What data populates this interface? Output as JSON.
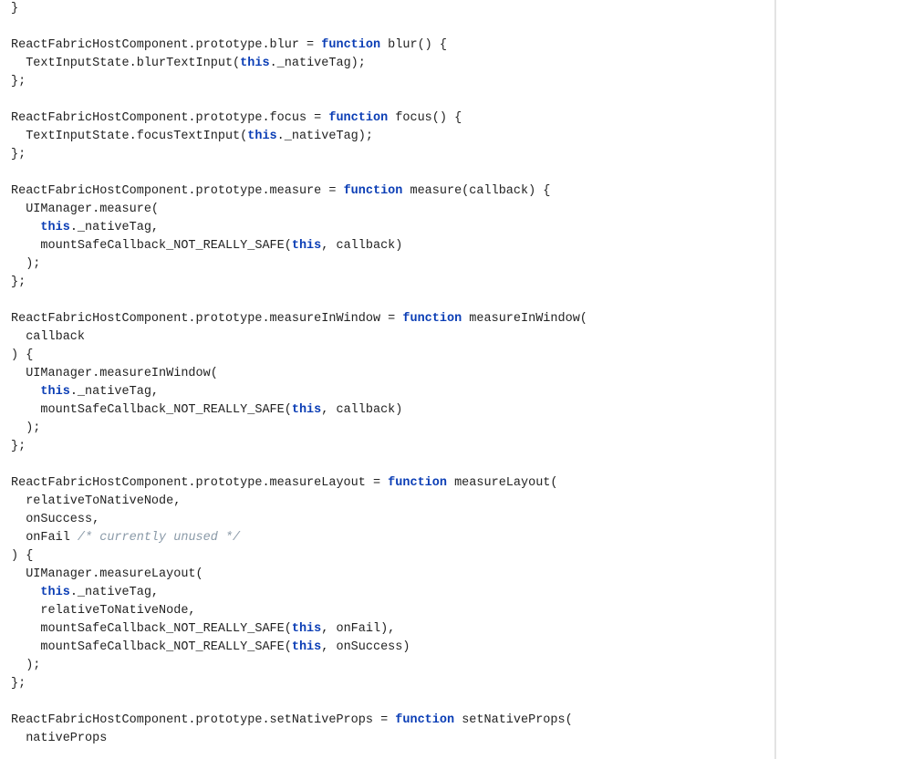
{
  "tokens": [
    {
      "t": "}",
      "c": ""
    },
    {
      "t": "\n",
      "c": ""
    },
    {
      "t": "\n",
      "c": ""
    },
    {
      "t": "ReactFabricHostComponent.prototype.blur = ",
      "c": ""
    },
    {
      "t": "function",
      "c": "kw"
    },
    {
      "t": " blur() {",
      "c": ""
    },
    {
      "t": "\n",
      "c": ""
    },
    {
      "t": "  TextInputState.blurTextInput(",
      "c": ""
    },
    {
      "t": "this",
      "c": "kw"
    },
    {
      "t": "._nativeTag);",
      "c": ""
    },
    {
      "t": "\n",
      "c": ""
    },
    {
      "t": "};",
      "c": ""
    },
    {
      "t": "\n",
      "c": ""
    },
    {
      "t": "\n",
      "c": ""
    },
    {
      "t": "ReactFabricHostComponent.prototype.focus = ",
      "c": ""
    },
    {
      "t": "function",
      "c": "kw"
    },
    {
      "t": " focus() {",
      "c": ""
    },
    {
      "t": "\n",
      "c": ""
    },
    {
      "t": "  TextInputState.focusTextInput(",
      "c": ""
    },
    {
      "t": "this",
      "c": "kw"
    },
    {
      "t": "._nativeTag);",
      "c": ""
    },
    {
      "t": "\n",
      "c": ""
    },
    {
      "t": "};",
      "c": ""
    },
    {
      "t": "\n",
      "c": ""
    },
    {
      "t": "\n",
      "c": ""
    },
    {
      "t": "ReactFabricHostComponent.prototype.measure = ",
      "c": ""
    },
    {
      "t": "function",
      "c": "kw"
    },
    {
      "t": " measure(callback) {",
      "c": ""
    },
    {
      "t": "\n",
      "c": ""
    },
    {
      "t": "  UIManager.measure(",
      "c": ""
    },
    {
      "t": "\n",
      "c": ""
    },
    {
      "t": "    ",
      "c": ""
    },
    {
      "t": "this",
      "c": "kw"
    },
    {
      "t": "._nativeTag,",
      "c": ""
    },
    {
      "t": "\n",
      "c": ""
    },
    {
      "t": "    mountSafeCallback_NOT_REALLY_SAFE(",
      "c": ""
    },
    {
      "t": "this",
      "c": "kw"
    },
    {
      "t": ", callback)",
      "c": ""
    },
    {
      "t": "\n",
      "c": ""
    },
    {
      "t": "  );",
      "c": ""
    },
    {
      "t": "\n",
      "c": ""
    },
    {
      "t": "};",
      "c": ""
    },
    {
      "t": "\n",
      "c": ""
    },
    {
      "t": "\n",
      "c": ""
    },
    {
      "t": "ReactFabricHostComponent.prototype.measureInWindow = ",
      "c": ""
    },
    {
      "t": "function",
      "c": "kw"
    },
    {
      "t": " measureInWindow(",
      "c": ""
    },
    {
      "t": "\n",
      "c": ""
    },
    {
      "t": "  callback",
      "c": ""
    },
    {
      "t": "\n",
      "c": ""
    },
    {
      "t": ") {",
      "c": ""
    },
    {
      "t": "\n",
      "c": ""
    },
    {
      "t": "  UIManager.measureInWindow(",
      "c": ""
    },
    {
      "t": "\n",
      "c": ""
    },
    {
      "t": "    ",
      "c": ""
    },
    {
      "t": "this",
      "c": "kw"
    },
    {
      "t": "._nativeTag,",
      "c": ""
    },
    {
      "t": "\n",
      "c": ""
    },
    {
      "t": "    mountSafeCallback_NOT_REALLY_SAFE(",
      "c": ""
    },
    {
      "t": "this",
      "c": "kw"
    },
    {
      "t": ", callback)",
      "c": ""
    },
    {
      "t": "\n",
      "c": ""
    },
    {
      "t": "  );",
      "c": ""
    },
    {
      "t": "\n",
      "c": ""
    },
    {
      "t": "};",
      "c": ""
    },
    {
      "t": "\n",
      "c": ""
    },
    {
      "t": "\n",
      "c": ""
    },
    {
      "t": "ReactFabricHostComponent.prototype.measureLayout = ",
      "c": ""
    },
    {
      "t": "function",
      "c": "kw"
    },
    {
      "t": " measureLayout(",
      "c": ""
    },
    {
      "t": "\n",
      "c": ""
    },
    {
      "t": "  relativeToNativeNode,",
      "c": ""
    },
    {
      "t": "\n",
      "c": ""
    },
    {
      "t": "  onSuccess,",
      "c": ""
    },
    {
      "t": "\n",
      "c": ""
    },
    {
      "t": "  onFail ",
      "c": ""
    },
    {
      "t": "/* currently unused */",
      "c": "cm"
    },
    {
      "t": "\n",
      "c": ""
    },
    {
      "t": ") {",
      "c": ""
    },
    {
      "t": "\n",
      "c": ""
    },
    {
      "t": "  UIManager.measureLayout(",
      "c": ""
    },
    {
      "t": "\n",
      "c": ""
    },
    {
      "t": "    ",
      "c": ""
    },
    {
      "t": "this",
      "c": "kw"
    },
    {
      "t": "._nativeTag,",
      "c": ""
    },
    {
      "t": "\n",
      "c": ""
    },
    {
      "t": "    relativeToNativeNode,",
      "c": ""
    },
    {
      "t": "\n",
      "c": ""
    },
    {
      "t": "    mountSafeCallback_NOT_REALLY_SAFE(",
      "c": ""
    },
    {
      "t": "this",
      "c": "kw"
    },
    {
      "t": ", onFail),",
      "c": ""
    },
    {
      "t": "\n",
      "c": ""
    },
    {
      "t": "    mountSafeCallback_NOT_REALLY_SAFE(",
      "c": ""
    },
    {
      "t": "this",
      "c": "kw"
    },
    {
      "t": ", onSuccess)",
      "c": ""
    },
    {
      "t": "\n",
      "c": ""
    },
    {
      "t": "  );",
      "c": ""
    },
    {
      "t": "\n",
      "c": ""
    },
    {
      "t": "};",
      "c": ""
    },
    {
      "t": "\n",
      "c": ""
    },
    {
      "t": "\n",
      "c": ""
    },
    {
      "t": "ReactFabricHostComponent.prototype.setNativeProps = ",
      "c": ""
    },
    {
      "t": "function",
      "c": "kw"
    },
    {
      "t": " setNativeProps(",
      "c": ""
    },
    {
      "t": "\n",
      "c": ""
    },
    {
      "t": "  nativeProps",
      "c": ""
    }
  ]
}
